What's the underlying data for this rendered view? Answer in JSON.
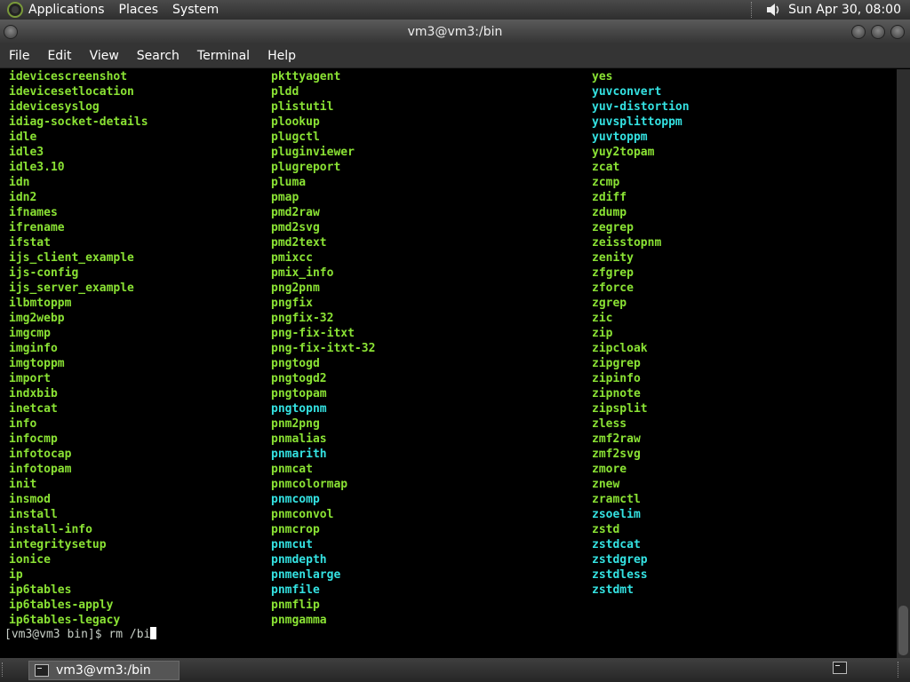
{
  "top_panel": {
    "menus": [
      "Applications",
      "Places",
      "System"
    ],
    "clock": "Sun Apr 30, 08:00",
    "icons": {
      "distro": "distro-logo-icon",
      "volume": "volume-icon"
    }
  },
  "window": {
    "title": "vm3@vm3:/bin"
  },
  "menubar": [
    "File",
    "Edit",
    "View",
    "Search",
    "Terminal",
    "Help"
  ],
  "terminal": {
    "columns": [
      [
        "idevicescreenshot",
        "idevicesetlocation",
        "idevicesyslog",
        "idiag-socket-details",
        "idle",
        "idle3",
        "idle3.10",
        "idn",
        "idn2",
        "ifnames",
        "ifrename",
        "ifstat",
        "ijs_client_example",
        "ijs-config",
        "ijs_server_example",
        "ilbmtoppm",
        "img2webp",
        "imgcmp",
        "imginfo",
        "imgtoppm",
        "import",
        "indxbib",
        "inetcat",
        "info",
        "infocmp",
        "infotocap",
        "infotopam",
        "init",
        "insmod",
        "install",
        "install-info",
        "integritysetup",
        "ionice",
        "ip",
        "ip6tables",
        "ip6tables-apply",
        "ip6tables-legacy"
      ],
      [
        "pkttyagent",
        "pldd",
        "plistutil",
        "plookup",
        "plugctl",
        "pluginviewer",
        "plugreport",
        "pluma",
        "pmap",
        "pmd2raw",
        "pmd2svg",
        "pmd2text",
        "pmixcc",
        "pmix_info",
        "png2pnm",
        "pngfix",
        "pngfix-32",
        "png-fix-itxt",
        "png-fix-itxt-32",
        "pngtogd",
        "pngtogd2",
        "pngtopam",
        "pngtopnm",
        "pnm2png",
        "pnmalias",
        "pnmarith",
        "pnmcat",
        "pnmcolormap",
        "pnmcomp",
        "pnmconvol",
        "pnmcrop",
        "pnmcut",
        "pnmdepth",
        "pnmenlarge",
        "pnmfile",
        "pnmflip",
        "pnmgamma"
      ],
      [
        "yes",
        "yuvconvert",
        "yuv-distortion",
        "yuvsplittoppm",
        "yuvtoppm",
        "yuy2topam",
        "zcat",
        "zcmp",
        "zdiff",
        "zdump",
        "zegrep",
        "zeisstopnm",
        "zenity",
        "zfgrep",
        "zforce",
        "zgrep",
        "zic",
        "zip",
        "zipcloak",
        "zipgrep",
        "zipinfo",
        "zipnote",
        "zipsplit",
        "zless",
        "zmf2raw",
        "zmf2svg",
        "zmore",
        "znew",
        "zramctl",
        "zsoelim",
        "zstd",
        "zstdcat",
        "zstdgrep",
        "zstdless",
        "zstdmt"
      ]
    ],
    "cyan_entries": [
      "pngtopnm",
      "pnmarith",
      "pnmcomp",
      "pnmcut",
      "pnmdepth",
      "pnmenlarge",
      "pnmfile",
      "zsoelim",
      "zstdcat",
      "zstdgrep",
      "zstdless",
      "zstdmt",
      "yuv-distortion",
      "yuvconvert",
      "yuvsplittoppm",
      "yuvtoppm"
    ],
    "prompt": "[vm3@vm3 bin]$ rm /bi"
  },
  "taskbar": {
    "item_label": "vm3@vm3:/bin",
    "icons": {
      "item": "terminal-icon",
      "tray": "terminal-icon"
    }
  },
  "colors": {
    "exec_green": "#8ae234",
    "link_cyan": "#34e2e2",
    "panel": "#3a3a3a"
  }
}
